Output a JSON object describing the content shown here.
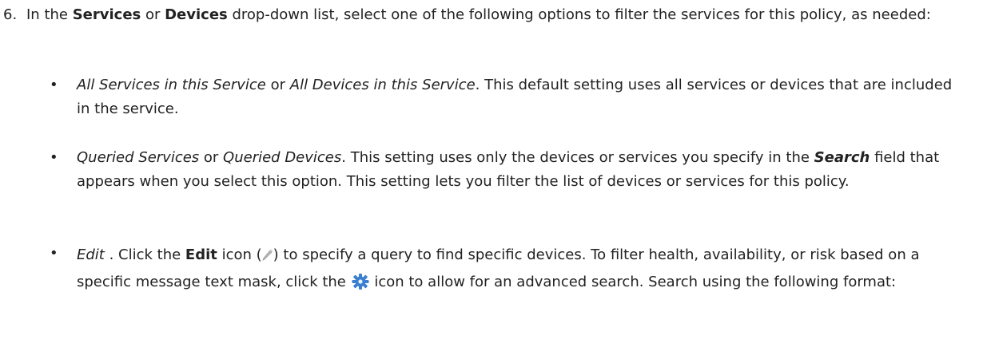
{
  "step": {
    "number": "6.",
    "t1": "In the ",
    "services": "Services",
    "t2": " or ",
    "devices": "Devices",
    "t3": " drop-down list, select one of the following options to filter the services for this policy, as needed:"
  },
  "bullets": [
    {
      "dot": "•",
      "i1": "All Services in this Service",
      "t1": " or ",
      "i2": "All Devices in this Service",
      "t2": ". This default setting uses all services or devices that are included in the service."
    },
    {
      "dot": "•",
      "i1": "Queried Services",
      "t1": " or ",
      "i2": "Queried Devices",
      "t2": ". This setting uses only the devices or services you specify in the ",
      "search": "Search",
      "t3": " field that appears when you select this option. This setting lets you filter the list of devices or services for this policy."
    },
    {
      "dot": "•",
      "i1": "Edit",
      "t1": " . Click the ",
      "edit": "Edit",
      "t2": " icon (",
      "t3": ") to specify a query to find specific devices. To filter health, availability, or risk based on a specific message text mask, click the ",
      "t4": " icon to allow for an advanced search. Search using the following format:"
    }
  ],
  "icons": {
    "edit_icon": "pencil-icon",
    "advanced_icon": "gear-icon",
    "gear_color": "#3a7fd0"
  }
}
